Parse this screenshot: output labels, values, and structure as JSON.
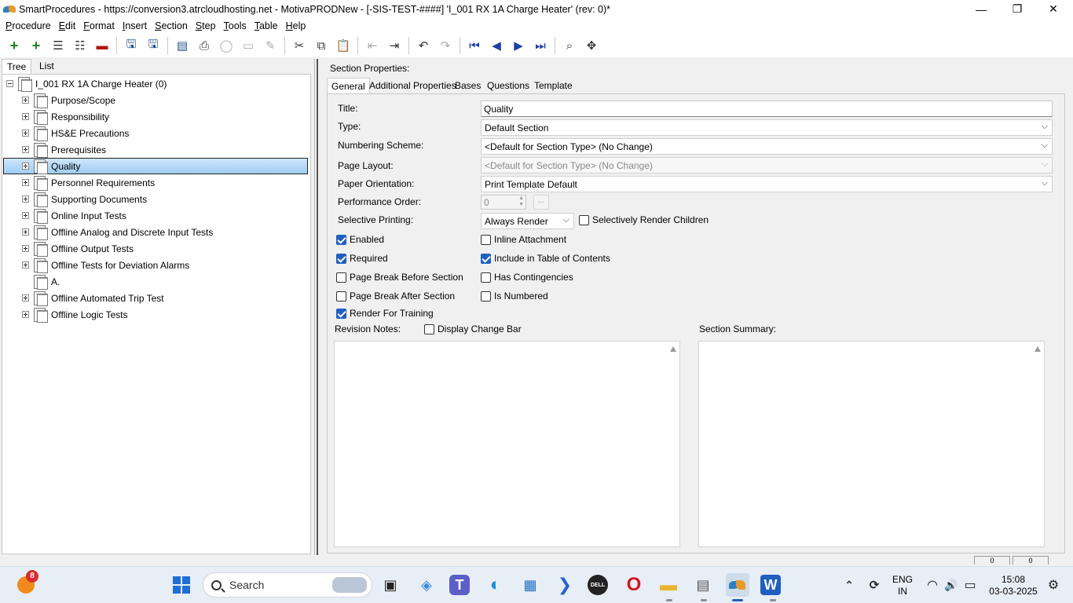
{
  "window": {
    "title": "SmartProcedures - https://conversion3.atrcloudhosting.net - MotivaPRODNew - [-SIS-TEST-####] 'I_001 RX 1A Charge Heater' (rev: 0)*",
    "minimize_glyph": "—",
    "maximize_glyph": "❐",
    "close_glyph": "✕"
  },
  "menu": {
    "items": [
      {
        "accel": "P",
        "rest": "rocedure"
      },
      {
        "accel": "E",
        "rest": "dit"
      },
      {
        "accel": "F",
        "rest": "ormat"
      },
      {
        "accel": "I",
        "rest": "nsert"
      },
      {
        "accel": "S",
        "rest": "ection"
      },
      {
        "accel": "S",
        "rest": "tep"
      },
      {
        "accel": "T",
        "rest": "ools"
      },
      {
        "accel": "T",
        "rest": "able"
      },
      {
        "accel": "H",
        "rest": "elp"
      }
    ]
  },
  "toolbar": {
    "icons": [
      "add-icon",
      "add-child-icon",
      "collapse-icon",
      "expand-icon",
      "remove-icon",
      "save-all-icon",
      "save-icon",
      "publish-icon",
      "print-icon",
      "refresh-icon",
      "preview-icon",
      "edit-icon",
      "cut-icon",
      "copy-icon",
      "paste-icon",
      "outdent-icon",
      "indent-icon",
      "undo-icon",
      "redo-icon",
      "first-icon",
      "previous-icon",
      "next-icon",
      "last-icon",
      "find-icon",
      "move-icon"
    ],
    "glyphs": {
      "add": "+",
      "add_child": "+",
      "collapse": "☰",
      "expand": "☷",
      "remove": "▬",
      "save_all": "🖫",
      "save": "🖫",
      "publish": "▤",
      "print": "⎙",
      "refresh": "◯",
      "preview": "▭",
      "edit": "✎",
      "cut": "✂",
      "copy": "⧉",
      "paste": "📋",
      "outdent": "⇤",
      "indent": "⇥",
      "undo": "↶",
      "redo": "↷",
      "first": "⏮",
      "previous": "◀",
      "next": "▶",
      "last": "⏭",
      "find": "⌕",
      "move": "✥"
    }
  },
  "left": {
    "tabs": [
      "Tree",
      "List"
    ],
    "root": "I_001 RX 1A Charge Heater (0)",
    "items": [
      "Purpose/Scope",
      "Responsibility",
      "HS&E Precautions",
      "Prerequisites",
      "Quality",
      "Personnel Requirements",
      "Supporting Documents",
      "Online Input Tests",
      "Offline Analog and Discrete Input Tests",
      "Offline Output Tests",
      "Offline Tests for Deviation Alarms",
      "A.",
      "Offline Automated Trip Test",
      "Offline Logic Tests"
    ],
    "selected_index": 4
  },
  "right": {
    "header": "Section Properties:",
    "tabs": [
      "General",
      "Additional Properties",
      "Bases",
      "Questions",
      "Template"
    ],
    "fields": {
      "title_label": "Title:",
      "title_value": "Quality",
      "type_label": "Type:",
      "type_value": "Default Section",
      "numbering_label": "Numbering Scheme:",
      "numbering_value": "<Default for Section Type> (No Change)",
      "page_layout_label": "Page Layout:",
      "page_layout_value": "<Default for Section Type> (No Change)",
      "orientation_label": "Paper Orientation:",
      "orientation_value": "Print Template Default",
      "perf_order_label": "Performance Order:",
      "perf_order_value": "0",
      "perf_order_button": "...",
      "selective_label": "Selective Printing:",
      "selective_value": "Always Render",
      "chevron": "⌵",
      "spin_up": "▲",
      "spin_down": "▼"
    },
    "checkboxes": {
      "selectively_render_children": "Selectively Render Children",
      "enabled": "Enabled",
      "inline_attachment": "Inline Attachment",
      "required": "Required",
      "include_toc": "Include in Table of Contents",
      "page_break_before": "Page Break Before Section",
      "has_contingencies": "Has Contingencies",
      "page_break_after": "Page Break After Section",
      "is_numbered": "Is Numbered",
      "render_for_training": "Render For Training",
      "display_change_bar": "Display Change Bar"
    },
    "revision_notes_label": "Revision Notes:",
    "section_summary_label": "Section Summary:"
  },
  "statusbar": {
    "box1": "0",
    "box2": "0"
  },
  "taskbar": {
    "notification_count": "8",
    "search_placeholder": "Search",
    "lang_line1": "ENG",
    "lang_line2": "IN",
    "time": "15:08",
    "date": "03-03-2025",
    "icons": [
      "weather-icon",
      "windows-start-icon",
      "search-icon",
      "task-view-icon",
      "copilot-icon",
      "teams-icon",
      "edge-icon",
      "store-icon",
      "remote-icon",
      "dell-icon",
      "opera-icon",
      "file-explorer-icon",
      "contacts-icon",
      "smartprocedures-icon",
      "word-icon",
      "chevron-up-icon",
      "network-icon",
      "wifi-icon",
      "volume-icon",
      "battery-icon",
      "notification-icon"
    ],
    "glyphs": {
      "task_view": "▣",
      "copilot": "◈",
      "teams": "T",
      "edge": "◐",
      "store": "▦",
      "remote": "❯",
      "dell": "DELL",
      "opera": "O",
      "explorer": "▬",
      "contacts": "▤",
      "word": "W",
      "chevron_up": "⌃",
      "network": "⟳",
      "wifi": "◠",
      "volume": "🔊",
      "battery": "▭",
      "notification": "⚙"
    }
  },
  "colors": {
    "selection": "#9fcdf5",
    "accent": "#1f5fbf",
    "nav": "#1a3fa6"
  }
}
